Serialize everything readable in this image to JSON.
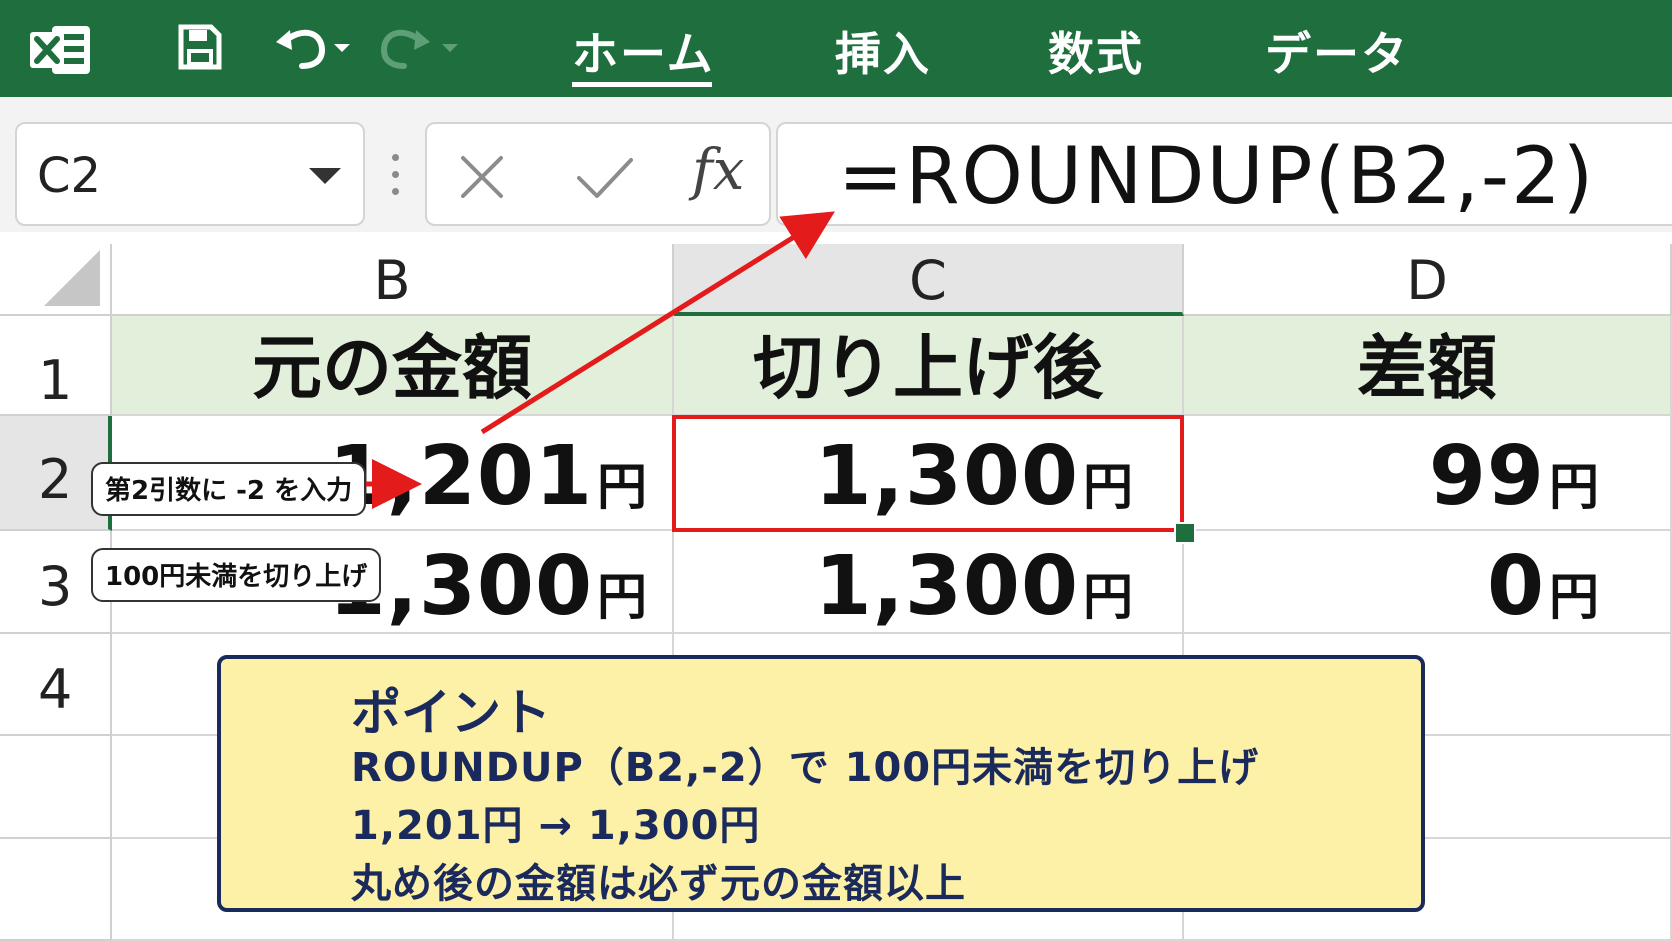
{
  "ribbon": {
    "app_icon": "excel-logo-icon",
    "quick_access": [
      "save-icon",
      "undo-icon",
      "redo-icon"
    ],
    "tabs": [
      {
        "label": "ホーム",
        "active": true
      },
      {
        "label": "挿入"
      },
      {
        "label": "数式"
      },
      {
        "label": "データ"
      }
    ]
  },
  "formula_bar": {
    "name_box": "C2",
    "formula": "=ROUNDUP(B2,-2)",
    "fx_label": "fx"
  },
  "columns": [
    "B",
    "C",
    "D"
  ],
  "rows": [
    "1",
    "2",
    "3",
    "4"
  ],
  "table": {
    "headers": [
      "元の金額",
      "切り上げ後",
      "差額"
    ],
    "data": [
      [
        {
          "value": "1,201",
          "unit": "円"
        },
        {
          "value": "1,300",
          "unit": "円"
        },
        {
          "value": "99",
          "unit": "円"
        }
      ],
      [
        {
          "value": "1,300",
          "unit": "円"
        },
        {
          "value": "1,300",
          "unit": "円"
        },
        {
          "value": "0",
          "unit": "円"
        }
      ]
    ]
  },
  "callouts": {
    "second_arg": "第2引数に -2 を入力",
    "roundup_note": "100円未満を切り上げ"
  },
  "point": {
    "title": "ポイント",
    "lines": [
      "ROUNDUP（B2,-2）で 100円未満を切り上げ",
      "1,201円 → 1,300円",
      "丸め後の金額は必ず元の金額以上"
    ]
  },
  "colors": {
    "ribbon": "#1f6e3d",
    "header_fill": "#e2efda",
    "highlight": "#e31b1b",
    "point_fill": "#fdf1a7",
    "point_border": "#1b2a5c"
  }
}
